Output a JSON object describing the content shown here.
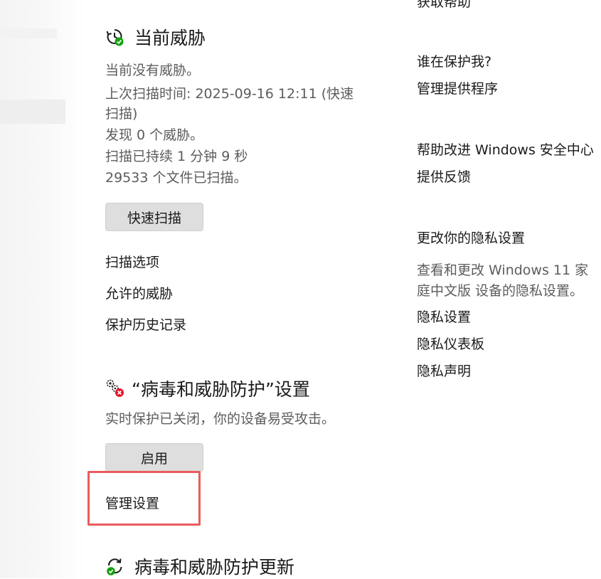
{
  "current_threats": {
    "title": "当前威胁",
    "icon": "history-clock-icon",
    "status_lines": [
      "当前没有威胁。",
      "上次扫描时间: 2025-09-16 12:11 (快速",
      "扫描)",
      "发现 0 个威胁。",
      "扫描已持续 1 分钟 9 秒",
      "29533 个文件已扫描。"
    ],
    "quick_scan_button": "快速扫描",
    "links": [
      "扫描选项",
      "允许的威胁",
      "保护历史记录"
    ]
  },
  "protection_settings": {
    "title": "“病毒和威胁防护”设置",
    "icon": "settings-gears-warning-icon",
    "status": "实时保护已关闭，你的设备易受攻击。",
    "enable_button": "启用",
    "manage_link": "管理设置"
  },
  "protection_updates": {
    "title": "病毒和威胁防护更新",
    "icon": "refresh-sync-icon"
  },
  "sidebar": {
    "top_link_partial": "获取帮助",
    "who_protects_heading": "谁在保护我?",
    "manage_providers": "管理提供程序",
    "improve_heading": "帮助改进 Windows 安全中心",
    "feedback_link": "提供反馈",
    "privacy_heading": "更改你的隐私设置",
    "privacy_desc_lines": [
      "查看和更改 Windows 11 家",
      "庭中文版 设备的隐私设置。"
    ],
    "privacy_links": [
      "隐私设置",
      "隐私仪表板",
      "隐私声明"
    ]
  },
  "colors": {
    "ok_green": "#13a10e",
    "warning_red": "#e81123",
    "highlight_red": "#ea5b5b"
  }
}
